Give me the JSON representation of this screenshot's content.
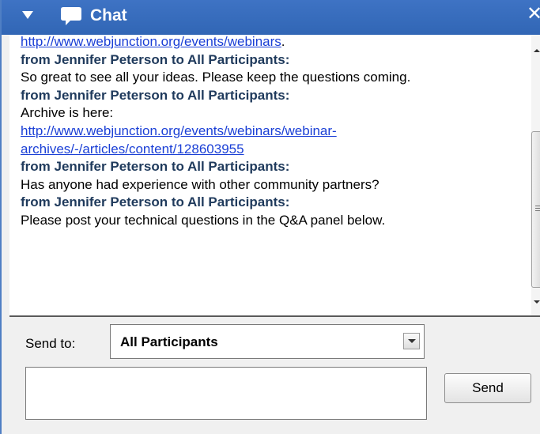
{
  "window": {
    "title": "Chat"
  },
  "icons": {
    "collapse": "triangle-down-icon",
    "chat": "speech-bubble-icon",
    "close": "close-icon"
  },
  "colors": {
    "titlebar": "#3a6fc0",
    "link": "#1a3fd6",
    "sender": "#1f3a5c"
  },
  "messages": [
    {
      "type": "link",
      "text": "http://www.webjunction.org/events/webinars",
      "suffix": "."
    },
    {
      "type": "from",
      "text": "from Jennifer Peterson to All Participants:"
    },
    {
      "type": "text",
      "text": "So great to see all your ideas. Please keep the questions coming."
    },
    {
      "type": "from",
      "text": "from Jennifer Peterson to All Participants:"
    },
    {
      "type": "text",
      "text": "Archive is here:"
    },
    {
      "type": "link",
      "text": "http://www.webjunction.org/events/webinars/webinar-"
    },
    {
      "type": "link",
      "text": "archives/-/articles/content/128603955"
    },
    {
      "type": "from",
      "text": "from Jennifer Peterson to All Participants:"
    },
    {
      "type": "text",
      "text": "Has anyone had experience with other community partners?"
    },
    {
      "type": "from",
      "text": "from Jennifer Peterson to All Participants:"
    },
    {
      "type": "text",
      "text": "Please post your technical questions in the Q&A panel below."
    }
  ],
  "composer": {
    "send_to_label": "Send to:",
    "recipient": "All Participants",
    "message_value": "",
    "send_label": "Send"
  }
}
